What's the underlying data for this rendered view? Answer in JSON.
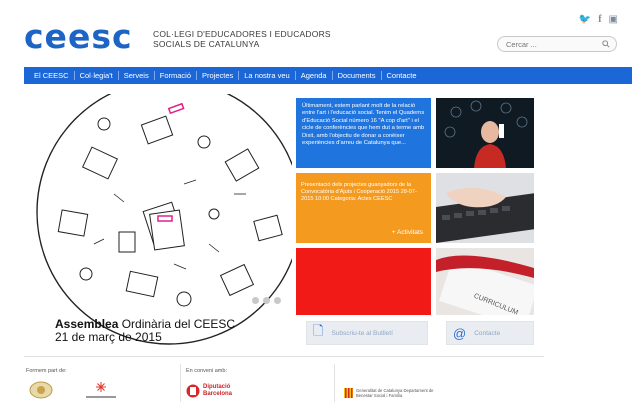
{
  "header": {
    "logo_text": "ceesc",
    "tagline_line1": "COL·LEGI D'EDUCADORES I EDUCADORS",
    "tagline_line2": "SOCIALS DE CATALUNYA",
    "search_placeholder": "Cercar ...",
    "social": [
      "twitter-icon",
      "facebook-icon",
      "instagram-icon"
    ]
  },
  "nav": {
    "items": [
      "El CEESC",
      "Col·legia't",
      "Serveis",
      "Formació",
      "Projectes",
      "La nostra veu",
      "Agenda",
      "Documents",
      "Contacte"
    ]
  },
  "hero": {
    "caption_bold": "Assemblea",
    "caption_rest": " Ordinària del CEESC",
    "caption_date": "21 de març de 2015",
    "slides": 3
  },
  "tiles": {
    "blue_text": "Últimament, estem parlant molt de la relació entre l'art i l'educació social. Tenim el Quaderns d'Educació Social número 16 \"A cop d'art\" i el cicle de conferències que hem dut a terme amb Dixit, amb l'objectiu de donar a conèixer experiències d'arreu de Catalunya que...",
    "orange_text": "Presentació dels projectes guanyadors de la Convocatòria d'Ajuts i Cooperació 2015 28-07-2015 10:00 Categoria: Actes CEESC",
    "orange_more": "+ Activitats"
  },
  "buttons": {
    "newsletter": "Subscriu-te al Butlletí",
    "contact": "Contacte"
  },
  "footer": {
    "member_of": "Formem part de:",
    "agreement": "En conveni amb:",
    "partner1": "Diputació Barcelona",
    "partner2": "Generalitat de Catalunya Departament de Benestar Social i Família"
  },
  "colors": {
    "brand_blue": "#1d64c5",
    "nav_blue": "#1c67d8",
    "tile_blue": "#1f74de",
    "tile_orange": "#f39a1f",
    "tile_red": "#f21a17"
  }
}
